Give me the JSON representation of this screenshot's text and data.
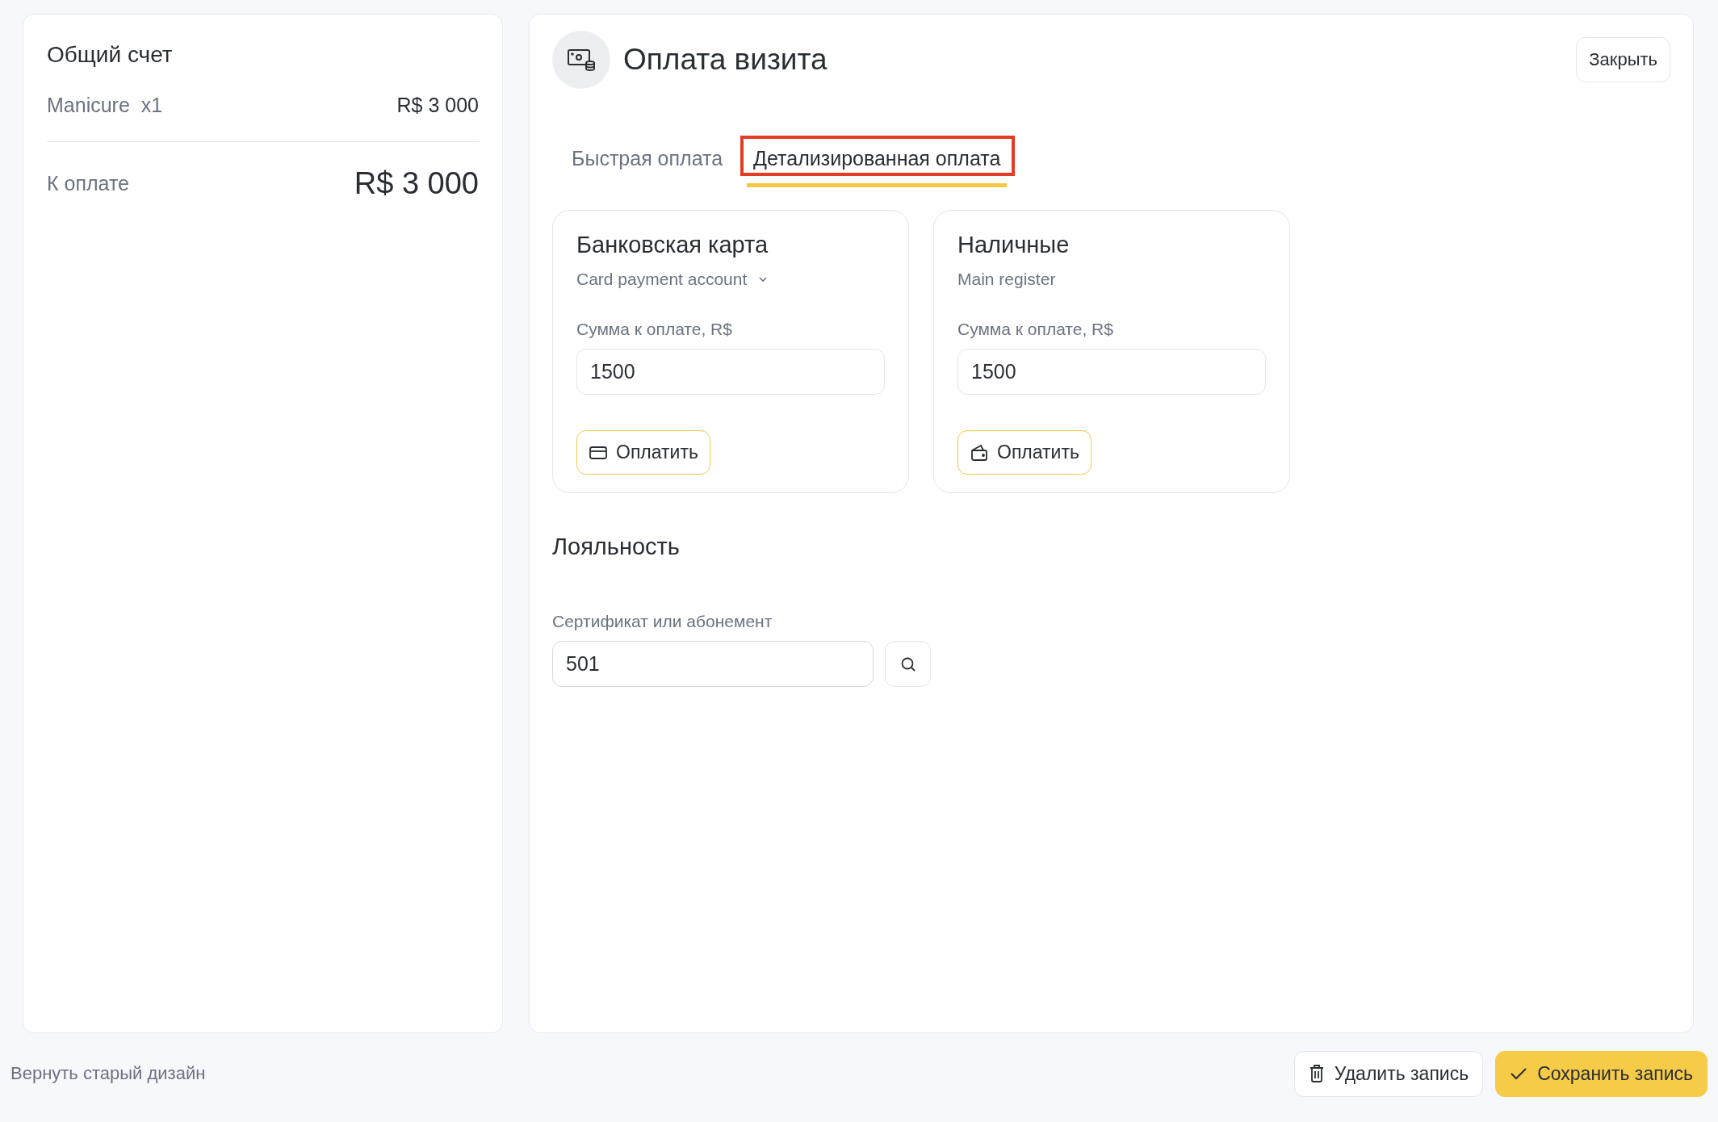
{
  "bill": {
    "title": "Общий счет",
    "items": [
      {
        "name": "Manicure",
        "qty": "x1",
        "price": "R$ 3 000"
      }
    ],
    "total_label": "К оплате",
    "total": "R$ 3 000"
  },
  "payment": {
    "title": "Оплата визита",
    "close": "Закрыть",
    "tabs": [
      {
        "label": "Быстрая оплата",
        "selected": false,
        "highlighted": false
      },
      {
        "label": "Детализированная оплата",
        "selected": true,
        "highlighted": true
      }
    ],
    "methods": [
      {
        "kind": "card",
        "title": "Банковская карта",
        "account": "Card payment account",
        "dropdown": true,
        "amount_label": "Сумма к оплате, R$",
        "amount": "1500",
        "button": "Оплатить"
      },
      {
        "kind": "cash",
        "title": "Наличные",
        "account": "Main register",
        "dropdown": false,
        "amount_label": "Сумма к оплате, R$",
        "amount": "1500",
        "button": "Оплатить"
      }
    ],
    "loyalty": {
      "title": "Лояльность",
      "label": "Сертификат или абонемент",
      "value": "501"
    }
  },
  "footer": {
    "link": "Вернуть старый дизайн",
    "delete": "Удалить запись",
    "save": "Сохранить запись"
  }
}
